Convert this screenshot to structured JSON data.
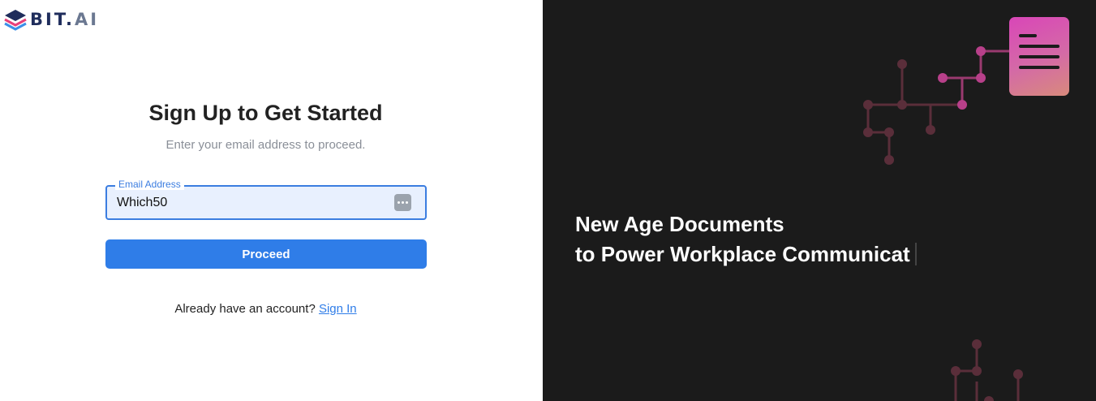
{
  "logo": {
    "brand": "BIT",
    "dot": ".",
    "suffix": "AI"
  },
  "signup": {
    "title": "Sign Up to Get Started",
    "subtitle": "Enter your email address to proceed.",
    "email_label": "Email Address",
    "email_value": "Which50",
    "proceed_label": "Proceed",
    "account_prompt": "Already have an account? ",
    "signin_label": "Sign In"
  },
  "hero": {
    "line1": "New Age Documents",
    "line2": "to Power Workplace Communicat"
  },
  "colors": {
    "accent": "#2f7de8",
    "brand_navy": "#1f2d5c",
    "hero_bg": "#1b1b1b",
    "doc_card": "#d946b8"
  },
  "icons": [
    "bit-ai-logo-icon",
    "password-manager-icon",
    "document-icon",
    "circuit-decoration-icon"
  ]
}
